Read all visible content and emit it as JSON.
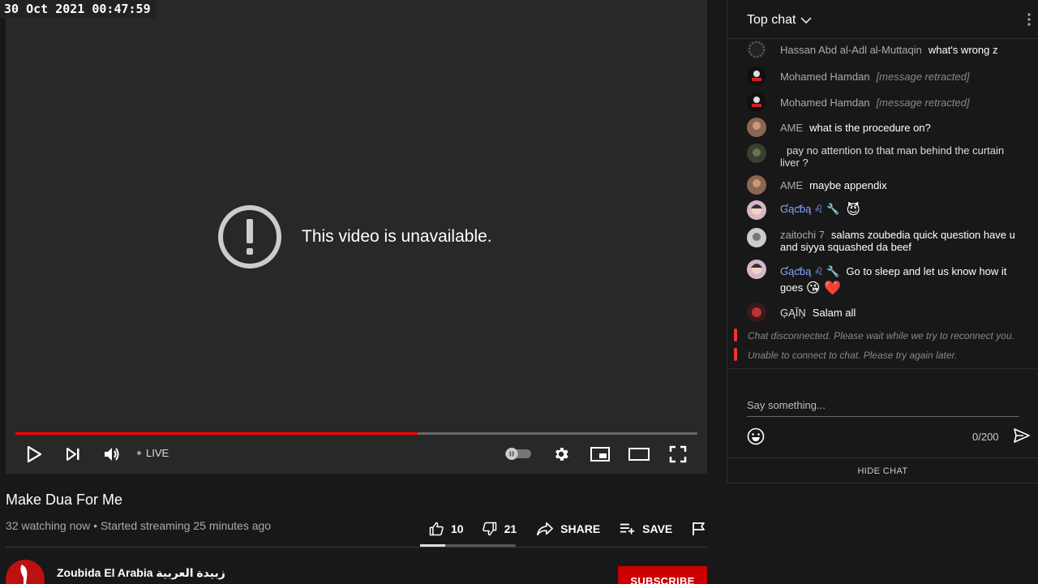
{
  "timestamp": "30 Oct 2021 00:47:59",
  "player": {
    "unavailable_message": "This video is unavailable.",
    "live_label": "LIVE",
    "progress": 0.59
  },
  "video": {
    "title": "Make Dua For Me",
    "meta": "32 watching now • Started streaming 25 minutes ago",
    "likes": "10",
    "dislikes": "21",
    "share_label": "SHARE",
    "save_label": "SAVE",
    "like_ratio": 0.26
  },
  "channel": {
    "name": "Zoubida El Arabia زبيدة العربية",
    "subscribe_label": "SUBSCRIBE"
  },
  "chat": {
    "header": "Top chat",
    "messages": [
      {
        "author": "Hassan Abd al-Adl al-Muttaqin",
        "text": "what's wrong z"
      },
      {
        "author": "Mohamed Hamdan",
        "text": "[message retracted]"
      },
      {
        "author": "Mohamed Hamdan",
        "text": "[message retracted]"
      },
      {
        "author": "AME",
        "text": "what is the procedure on?"
      },
      {
        "author": "",
        "text": "pay no attention to that man behind the curtain liver ?"
      },
      {
        "author": "AME",
        "text": "maybe appendix"
      },
      {
        "author": "Ɠąƈɓą ♌ 🔧",
        "text": "😈"
      },
      {
        "author": "zaitochi 7",
        "text": "salams zoubedia quick question have u and siyya squashed da beef"
      },
      {
        "author": "Ɠąƈɓą ♌ 🔧",
        "text": "Go to sleep and let us know how it goes",
        "emojis": "😘 ❤️"
      },
      {
        "author": "ĢĄĬŅ",
        "text": "Salam all"
      }
    ],
    "system_messages": [
      "Chat disconnected. Please wait while we try to reconnect you.",
      "Unable to connect to chat. Please try again later."
    ],
    "input_placeholder": "Say something...",
    "char_count": "0/200",
    "hide_chat_label": "HIDE CHAT"
  }
}
